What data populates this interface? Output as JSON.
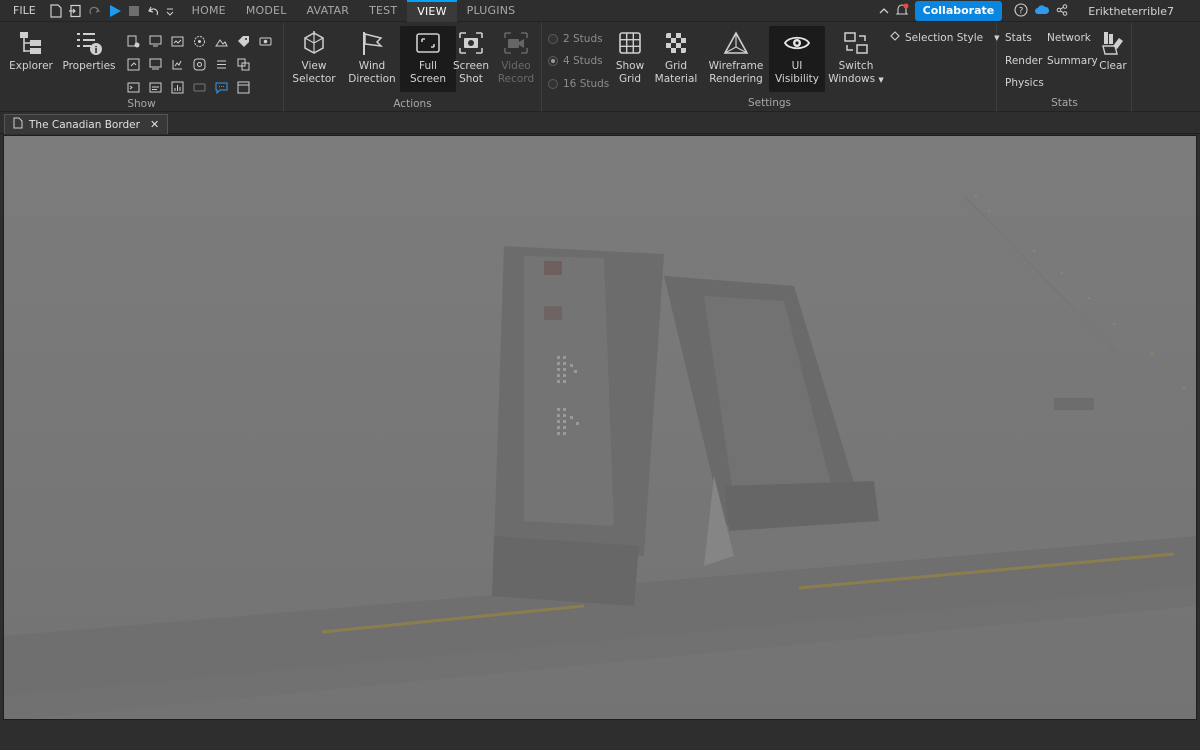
{
  "menubar": {
    "file_label": "FILE",
    "tabs": [
      {
        "label": "HOME"
      },
      {
        "label": "MODEL"
      },
      {
        "label": "AVATAR"
      },
      {
        "label": "TEST"
      },
      {
        "label": "VIEW",
        "active": true
      },
      {
        "label": "PLUGINS"
      }
    ],
    "collaborate_label": "Collaborate",
    "username": "Eriktheterrible7",
    "icons": [
      "new-file-icon",
      "import-icon",
      "redo-icon",
      "play-icon",
      "stop-icon",
      "undo-icon",
      "dropdown-icon",
      "collapse-icon",
      "notification-icon",
      "help-icon",
      "cloud-icon",
      "share-icon"
    ],
    "accent": "#00a2ff",
    "collaborate_color": "#0a86e0"
  },
  "ribbon": {
    "show": {
      "label": "Show",
      "explorer": "Explorer",
      "properties": "Properties"
    },
    "actions": {
      "label": "Actions",
      "view_selector": [
        "View",
        "Selector"
      ],
      "wind_direction": [
        "Wind",
        "Direction"
      ],
      "full_screen": [
        "Full",
        "Screen"
      ],
      "screen_shot": [
        "Screen",
        "Shot"
      ],
      "video_record": [
        "Video",
        "Record"
      ]
    },
    "settings": {
      "label": "Settings",
      "studs": [
        "2 Studs",
        "4 Studs",
        "16 Studs"
      ],
      "selected_stud": "4 Studs",
      "show_grid": [
        "Show",
        "Grid"
      ],
      "grid_material": [
        "Grid",
        "Material"
      ],
      "wireframe": [
        "Wireframe",
        "Rendering"
      ],
      "ui_visibility": "UI Visibility",
      "switch_windows": [
        "Switch",
        "Windows"
      ],
      "selection_style": "Selection Style"
    },
    "stats": {
      "label": "Stats",
      "stats": "Stats",
      "network": "Network",
      "render": "Render",
      "summary": "Summary",
      "physics": "Physics",
      "clear": "Clear"
    }
  },
  "document": {
    "tab_title": "The Canadian Border",
    "close_icon": "close-icon"
  },
  "viewport": {
    "fog_color": "#7a7a7a",
    "road_line_color": "#9a8a4a"
  }
}
